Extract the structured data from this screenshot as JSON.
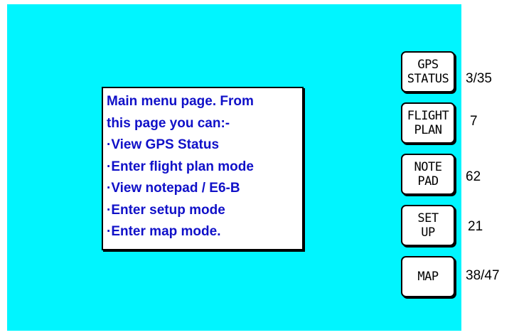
{
  "info": {
    "lines": [
      "Main menu page. From",
      "this page you can:-",
      "·View GPS Status",
      "·Enter flight plan mode",
      "·View notepad / E6-B",
      "·Enter setup mode",
      "·Enter map mode."
    ]
  },
  "buttons": [
    {
      "line1": "GPS",
      "line2": "STATUS",
      "value": "3/35"
    },
    {
      "line1": "FLIGHT",
      "line2": "PLAN",
      "value": "7"
    },
    {
      "line1": "NOTE",
      "line2": "PAD",
      "value": "62"
    },
    {
      "line1": "SET",
      "line2": "UP",
      "value": "21"
    },
    {
      "line1": "MAP",
      "line2": "",
      "value": "38/47"
    }
  ],
  "colors": {
    "screen_background": "#00f5ff",
    "info_text": "#1010c8",
    "button_background": "#ffffff"
  }
}
